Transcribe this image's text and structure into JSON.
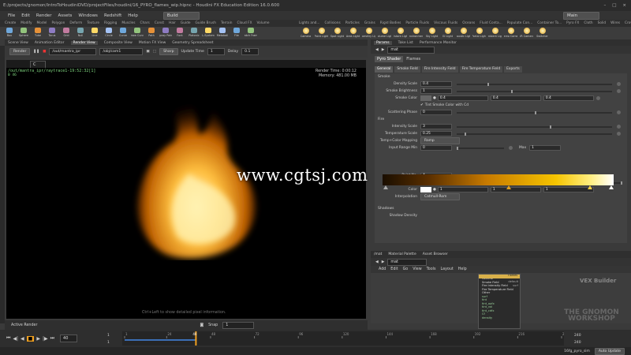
{
  "window": {
    "title": "E:/projects/gnomon/IntroToHoudiniDVD/projectFiles/houdini/16_PYRO_flames_wip.hipnc - Houdini FX Education Edition 16.0.600",
    "controls": [
      "–",
      "□",
      "×"
    ]
  },
  "menu": [
    "File",
    "Edit",
    "Render",
    "Assets",
    "Windows",
    "Redshift",
    "Help"
  ],
  "desktop": {
    "left": "Build",
    "right": "Main"
  },
  "shelf_tabs_left": [
    "Create",
    "Modify",
    "Model",
    "Polygon",
    "Deform",
    "Texture",
    "Rigging",
    "Muscles",
    "Chars",
    "Const",
    "Hair",
    "Guide",
    "Guide Brush",
    "Terrain",
    "Cloud FX",
    "Volume"
  ],
  "shelf_tabs_right": [
    "Lights and...",
    "Collisions",
    "Particles",
    "Grains",
    "Rigid Bodies",
    "Particle Fluids",
    "Viscous Fluids",
    "Oceans",
    "Fluid Conta...",
    "Populate Con...",
    "Container To...",
    "Pyro FX",
    "Cloth",
    "Solid",
    "Wires",
    "Crowds",
    "Drive Simul..."
  ],
  "shelf_tools_left": [
    "Box",
    "Sphere",
    "Tube",
    "Torus",
    "Grid",
    "Null",
    "Line",
    "Circle",
    "Curve",
    "Draw Curve",
    "Path",
    "Spray Paint",
    "Font",
    "Platonic",
    "L-System",
    "Metaball",
    "File",
    "Batch Frame"
  ],
  "shelf_tools_right": [
    "Camera",
    "Point Light",
    "Spot Light",
    "Area Light",
    "Geometry Light",
    "Volume Light",
    "Distant Light",
    "Environment",
    "Sky Light",
    "GI Light",
    "Caustic Light",
    "Portal Light",
    "Ambient Light",
    "Stereo Camera",
    "VR Camera",
    "Switcher"
  ],
  "left_pane_tabs": [
    "Scene View",
    "Animation Editor",
    "Render View",
    "Composite View",
    "Motion FX View",
    "Geometry Spreadsheet"
  ],
  "left_active_tab": "Render View",
  "render_toolbar": {
    "render_label": "Render",
    "rop_path": "/out/mantra_ipr",
    "camera": "/obj/cam1",
    "sharp_label": "Sharp",
    "update_time_label": "Update Time",
    "update_time_value": "1",
    "delay_label": "Delay",
    "delay_value": "0.1",
    "zoom": "C"
  },
  "viewport": {
    "rop_line": "/out/mantra_ipr/raytrace1-19:52:32[1]",
    "xy_line": "0 46",
    "render_time": "Render Time: 0:00:12",
    "memory": "Memory:  481.00 MB",
    "hint": "Ctrl+Left to show detailed pixel information.",
    "watermark": "www.cgtsj.com"
  },
  "left_bottom": {
    "tab": "Active Render",
    "snap_label": "Snap",
    "snap_value": "1"
  },
  "right_pane_tabs": [
    "Params",
    "Take List",
    "Performance Monitor"
  ],
  "param_path": "mat",
  "shader": {
    "type": "Pyro Shader",
    "name": "Flames"
  },
  "shader_tabs": [
    "General",
    "Smoke Field",
    "Fire Intensity Field",
    "Fire Temperature Field",
    "Exports"
  ],
  "params": {
    "smoke_section": "Smoke",
    "density_scale_label": "Density Scale",
    "density_scale": "0.4",
    "smoke_brightness_label": "Smoke Brightness",
    "smoke_brightness": "1",
    "smoke_color_label": "Smoke Color",
    "smoke_color": [
      "0.4",
      "0.4",
      "0.4"
    ],
    "tint_label": "Tint Smoke Color with Cd",
    "scattering_label": "Scattering Phase",
    "scattering": "0",
    "fire_section": "Fire",
    "intensity_label": "Intensity Scale",
    "intensity": "3",
    "temperature_label": "Temperature Scale",
    "temperature": "0.25",
    "mapping_label": "Temp+Color Mapping",
    "mapping": "Ramp",
    "input_range_label": "Input Range Min",
    "input_min": "0",
    "max_label": "Max",
    "input_max": "1",
    "point_no_label": "Point No.",
    "point_no": "4",
    "position_label": "Position",
    "position": "1",
    "color_label": "Color",
    "color": [
      "1",
      "1",
      "1"
    ],
    "interp_label": "Interpolation",
    "interp": "Catmull-Rom",
    "shadows_section": "Shadows",
    "shadow_density_label": "Shadow Density"
  },
  "network_tabs": [
    "/mat",
    "Material Palette",
    "Asset Browser"
  ],
  "network_path": "mat",
  "network_menu": [
    "Add",
    "Edit",
    "Go",
    "View",
    "Tools",
    "Layout",
    "Help"
  ],
  "network_label": "VEX Builder",
  "vex_node": {
    "title": "Flames",
    "inputs": [
      "General",
      "Smoke Field",
      "Fire Intensity Field",
      "Fire Temperature Field",
      "Other"
    ],
    "ports": [
      "surf",
      "tint",
      "tint_opfx",
      "tint_vol",
      "tint_cdfx",
      "Cf",
      "density"
    ],
    "outputs": [
      "default",
      "surf"
    ]
  },
  "gnomon_logo": "THE GNOMON WORKSHOP",
  "timeline": {
    "current_frame": "40",
    "start": "1",
    "start2": "1",
    "end": "240",
    "end2": "240",
    "ticks": [
      "1",
      "24",
      "48",
      "72",
      "96",
      "120",
      "144",
      "168",
      "192",
      "216",
      "240"
    ],
    "current": 40,
    "range": [
      1,
      240
    ]
  },
  "status": {
    "file": "16fg_pyro_sim",
    "mode": "Auto Update"
  },
  "colors": {
    "accent": "#f0a020",
    "ramp_start": "#1a0e00",
    "ramp_end": "#ffffff"
  }
}
